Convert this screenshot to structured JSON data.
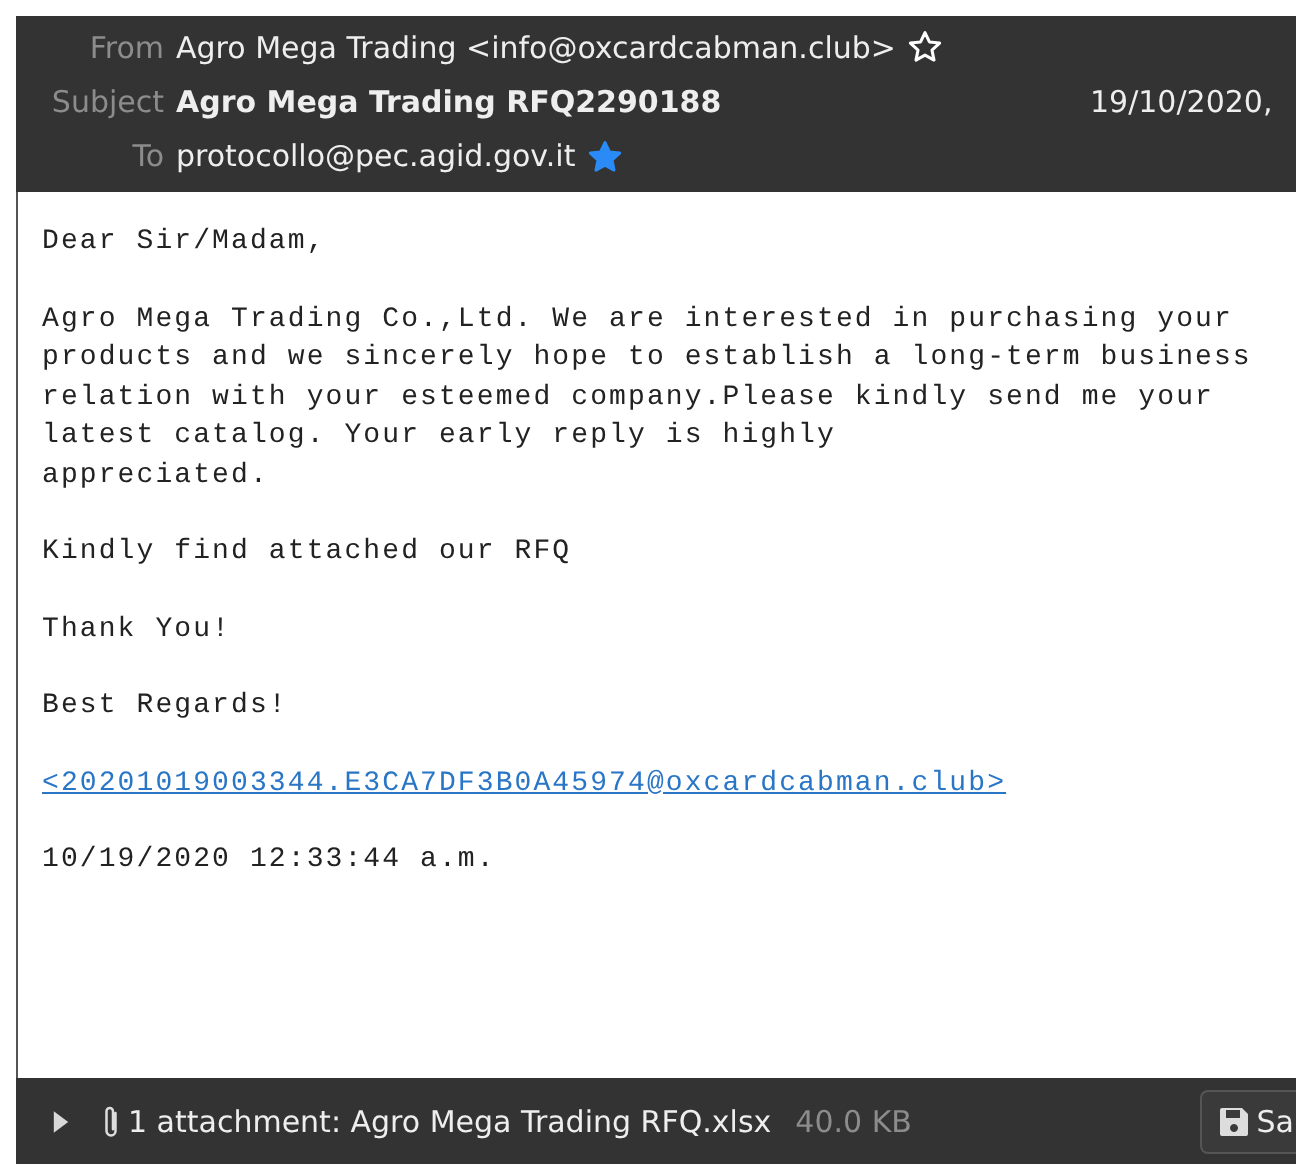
{
  "header": {
    "fields": [
      {
        "label": "From",
        "value": "Agro Mega Trading <info@oxcardcabman.club>",
        "kind": "from",
        "starred": false
      },
      {
        "label": "Subject",
        "value": "Agro Mega Trading RFQ2290188",
        "kind": "subject",
        "date": "19/10/2020,"
      },
      {
        "label": "To",
        "value": "protocollo@pec.agid.gov.it",
        "kind": "to",
        "starred": true
      }
    ]
  },
  "body": {
    "blocks": [
      {
        "kind": "text",
        "text": "Dear Sir/Madam,"
      },
      {
        "kind": "text",
        "text": "Agro Mega Trading Co.,Ltd. We are interested in purchasing your\nproducts and we sincerely hope to establish a long-term business\nrelation with your esteemed company.Please kindly send me your\nlatest catalog. Your early reply is highly\nappreciated."
      },
      {
        "kind": "text",
        "text": "Kindly find attached our RFQ"
      },
      {
        "kind": "text",
        "text": "Thank You!"
      },
      {
        "kind": "text",
        "text": "Best Regards!"
      },
      {
        "kind": "link",
        "text": "<20201019003344.E3CA7DF3B0A45974@oxcardcabman.club>"
      },
      {
        "kind": "text",
        "text": "10/19/2020 12:33:44 a.m."
      }
    ]
  },
  "attachments": {
    "expanded": false,
    "summary": "1 attachment: Agro Mega Trading RFQ.xlsx",
    "size": "40.0 KB",
    "save_button": "Sa"
  }
}
